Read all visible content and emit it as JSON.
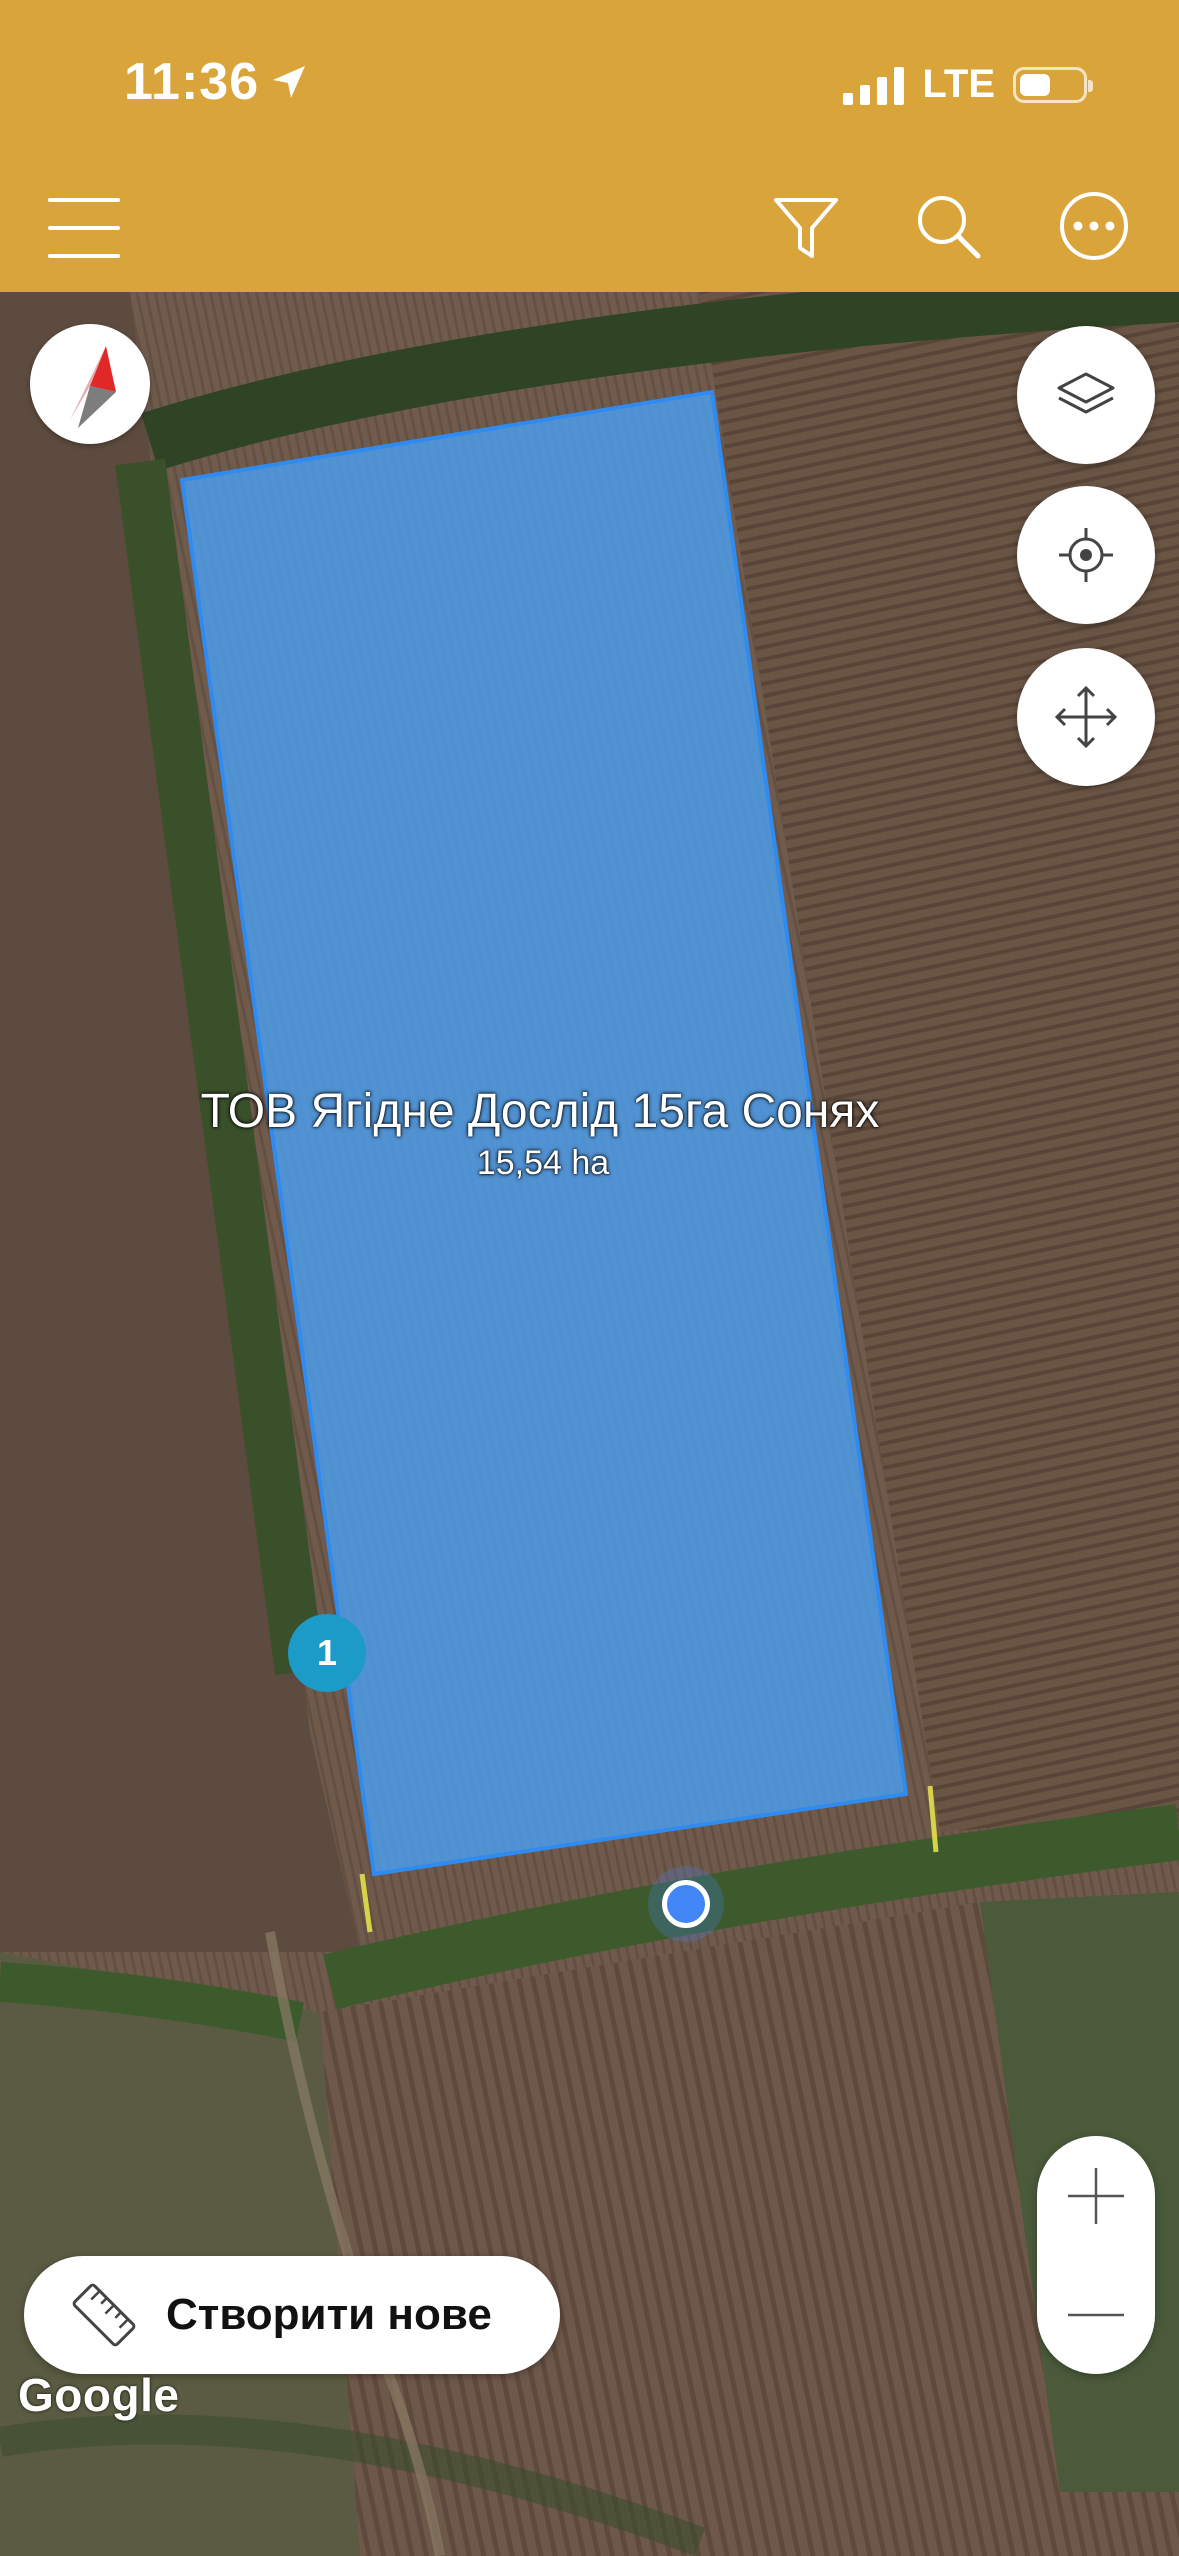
{
  "status_bar": {
    "time": "11:36",
    "network": "LTE"
  },
  "toolbar": {
    "menu_icon": "hamburger-menu-icon",
    "filter_icon": "filter-icon",
    "search_icon": "search-icon",
    "more_icon": "more-options-icon"
  },
  "map": {
    "field_name": "ТОВ Ягідне Дослід 15га Сонях",
    "field_area": "15,54 ha",
    "marker_label": "1",
    "field_color": "#4a9ff0",
    "controls": {
      "compass_icon": "compass-icon",
      "layers_icon": "layers-icon",
      "locate_icon": "my-location-icon",
      "move_icon": "move-arrows-icon"
    },
    "zoom_in_icon": "plus-icon",
    "zoom_out_icon": "minus-icon",
    "attribution": "Google"
  },
  "create_button": {
    "label": "Створити нове",
    "icon": "ruler-icon"
  },
  "colors": {
    "toolbar": "#d9a43a",
    "location_dot": "#4285f4",
    "marker": "#1c9ac8"
  }
}
